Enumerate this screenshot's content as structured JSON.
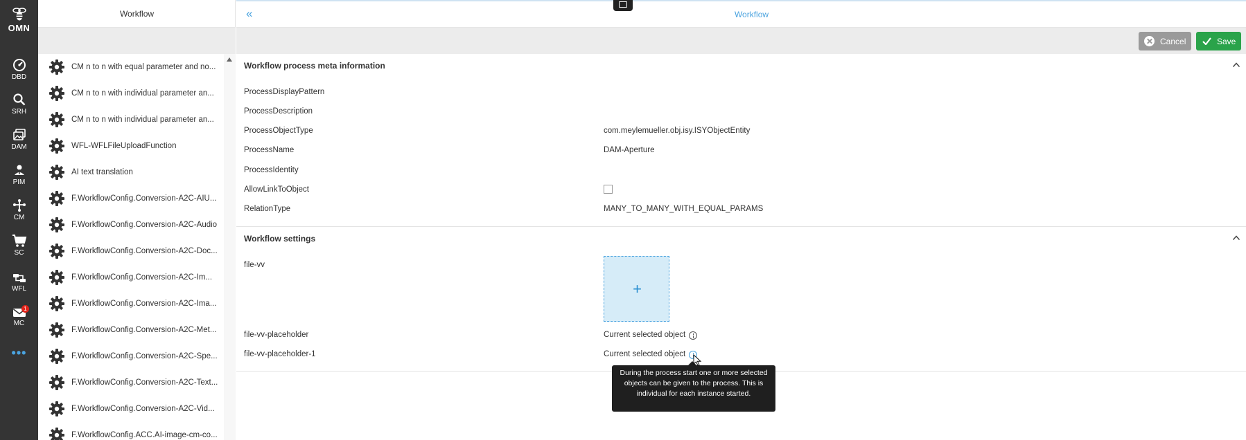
{
  "app": {
    "logo_text": "OMN"
  },
  "nav": {
    "items": [
      {
        "label": "DBD",
        "icon": "dashboard-icon"
      },
      {
        "label": "SRH",
        "icon": "search-icon"
      },
      {
        "label": "DAM",
        "icon": "images-icon"
      },
      {
        "label": "PIM",
        "icon": "flower-icon"
      },
      {
        "label": "CM",
        "icon": "network-icon"
      },
      {
        "label": "SC",
        "icon": "cart-icon"
      },
      {
        "label": "WFL",
        "icon": "workflow-icon"
      },
      {
        "label": "MC",
        "icon": "mail-icon",
        "badge": "1"
      }
    ],
    "more": "•••"
  },
  "list_panel": {
    "title": "Workflow",
    "items": [
      "CM n to n with equal parameter and no...",
      "CM n to n with individual parameter an...",
      "CM n to n with individual parameter an...",
      "WFL-WFLFileUploadFunction",
      "AI text translation",
      "F.WorkflowConfig.Conversion-A2C-AIU...",
      "F.WorkflowConfig.Conversion-A2C-Audio",
      "F.WorkflowConfig.Conversion-A2C-Doc...",
      "F.WorkflowConfig.Conversion-A2C-Im...",
      "F.WorkflowConfig.Conversion-A2C-Ima...",
      "F.WorkflowConfig.Conversion-A2C-Met...",
      "F.WorkflowConfig.Conversion-A2C-Spe...",
      "F.WorkflowConfig.Conversion-A2C-Text...",
      "F.WorkflowConfig.Conversion-A2C-Vid...",
      "F.WorkflowConfig.ACC.AI-image-cm-co..."
    ]
  },
  "main": {
    "collapse": "«",
    "title": "Workflow",
    "toolbar": {
      "cancel_label": "Cancel",
      "save_label": "Save"
    },
    "meta_section": {
      "title": "Workflow process meta information",
      "fields": {
        "display_pattern": {
          "label": "ProcessDisplayPattern",
          "value": ""
        },
        "description": {
          "label": "ProcessDescription",
          "value": ""
        },
        "object_type": {
          "label": "ProcessObjectType",
          "value": "com.meylemueller.obj.isy.ISYObjectEntity"
        },
        "name": {
          "label": "ProcessName",
          "value": "DAM-Aperture"
        },
        "identity": {
          "label": "ProcessIdentity",
          "value": ""
        },
        "allow_link": {
          "label": "AllowLinkToObject",
          "checked": false
        },
        "relation_type": {
          "label": "RelationType",
          "value": "MANY_TO_MANY_WITH_EQUAL_PARAMS"
        }
      }
    },
    "settings_section": {
      "title": "Workflow settings",
      "file_vv": {
        "label": "file-vv",
        "upload_symbol": "+"
      },
      "placeholder": {
        "label": "file-vv-placeholder",
        "value": "Current selected object"
      },
      "placeholder_1": {
        "label": "file-vv-placeholder-1",
        "value": "Current selected object"
      }
    },
    "tooltip": "During the process start one or more selected objects can be given to the process. This is individual for each instance started."
  },
  "colors": {
    "accent": "#4aa3df",
    "save": "#2aa34a",
    "cancel": "#9a9a9a",
    "rail": "#343434"
  }
}
